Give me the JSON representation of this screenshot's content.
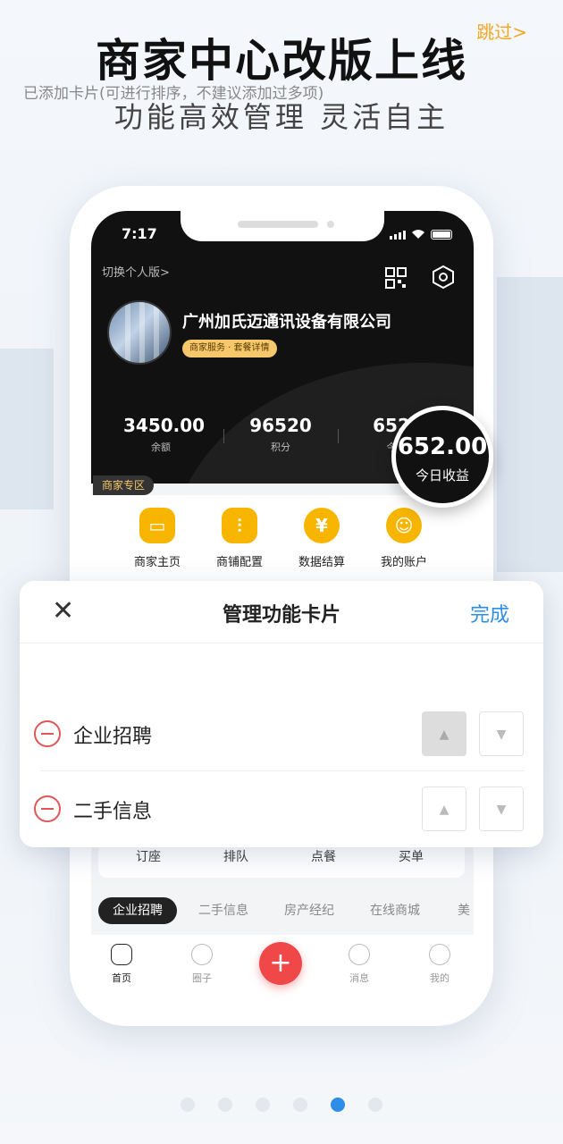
{
  "skip_label": "跳过>",
  "headline": "商家中心改版上线",
  "subline": "功能高效管理 灵活自主",
  "status_bar": {
    "time": "7:17"
  },
  "hero": {
    "switch_label": "切换个人版>",
    "company_name": "广州加氏迈通讯设备有限公司",
    "tag": "商家服务 · 套餐详情",
    "stats": [
      {
        "value": "3450.00",
        "label": "余额"
      },
      {
        "value": "96520",
        "label": "积分"
      },
      {
        "value": "652",
        "label": "今"
      }
    ]
  },
  "earnings_bubble": {
    "value": "652.00",
    "label": "今日收益"
  },
  "merchant_zone": {
    "tag": "商家专区",
    "items": [
      {
        "label": "商家主页",
        "icon": "storefront-icon"
      },
      {
        "label": "商铺配置",
        "icon": "sliders-icon"
      },
      {
        "label": "数据结算",
        "icon": "yen-icon"
      },
      {
        "label": "我的账户",
        "icon": "smiley-icon"
      }
    ]
  },
  "lower_card": {
    "items": [
      "订座",
      "排队",
      "点餐",
      "买单"
    ]
  },
  "categories": {
    "items": [
      "企业招聘",
      "二手信息",
      "房产经纪",
      "在线商城",
      "美"
    ]
  },
  "tabbar": {
    "items": [
      {
        "label": "首页",
        "icon": "home-icon"
      },
      {
        "label": "圈子",
        "icon": "circle-icon"
      },
      {
        "label": "消息",
        "icon": "message-icon"
      },
      {
        "label": "我的",
        "icon": "profile-icon"
      }
    ],
    "plus": "+"
  },
  "modal": {
    "title": "管理功能卡片",
    "close": "✕",
    "done": "完成",
    "hint": "已添加卡片(可进行排序，不建议添加过多项)",
    "rows": [
      {
        "name": "企业招聘",
        "up_disabled": true
      },
      {
        "name": "二手信息",
        "up_disabled": false
      }
    ],
    "up_glyph": "▲",
    "down_glyph": "▼"
  },
  "pagination": {
    "count": 6,
    "active_index": 4
  },
  "colors": {
    "accent": "#2e8de6",
    "gold": "#f7b500",
    "danger": "#e05656",
    "skip": "#f5a623"
  }
}
